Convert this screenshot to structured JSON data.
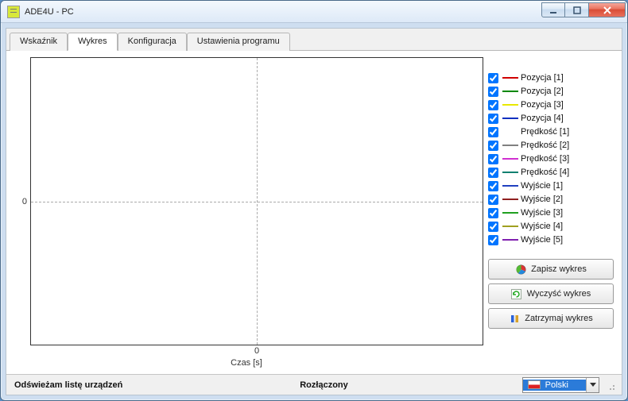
{
  "window": {
    "title": "ADE4U - PC"
  },
  "tabs": [
    {
      "label": "Wskaźnik"
    },
    {
      "label": "Wykres"
    },
    {
      "label": "Konfiguracja"
    },
    {
      "label": "Ustawienia programu"
    }
  ],
  "active_tab": 1,
  "chart_data": {
    "type": "line",
    "title": "",
    "xlabel": "Czas [s]",
    "ylabel": "",
    "x_ticks": [
      0
    ],
    "y_ticks": [
      0
    ],
    "xlim": [
      -1,
      1
    ],
    "ylim": [
      -1,
      1
    ],
    "series": [
      {
        "name": "Pozycja [1]",
        "color": "#d00000",
        "x": [],
        "y": []
      },
      {
        "name": "Pozycja [2]",
        "color": "#008800",
        "x": [],
        "y": []
      },
      {
        "name": "Pozycja [3]",
        "color": "#e8e800",
        "x": [],
        "y": []
      },
      {
        "name": "Pozycja [4]",
        "color": "#1030c0",
        "x": [],
        "y": []
      },
      {
        "name": "Prędkość [1]",
        "color": "#ffffff",
        "x": [],
        "y": []
      },
      {
        "name": "Prędkość [2]",
        "color": "#808080",
        "x": [],
        "y": []
      },
      {
        "name": "Prędkość [3]",
        "color": "#d030d0",
        "x": [],
        "y": []
      },
      {
        "name": "Prędkość [4]",
        "color": "#108070",
        "x": [],
        "y": []
      },
      {
        "name": "Wyjście [1]",
        "color": "#2040c0",
        "x": [],
        "y": []
      },
      {
        "name": "Wyjście [2]",
        "color": "#902020",
        "x": [],
        "y": []
      },
      {
        "name": "Wyjście [3]",
        "color": "#20a020",
        "x": [],
        "y": []
      },
      {
        "name": "Wyjście [4]",
        "color": "#a0a020",
        "x": [],
        "y": []
      },
      {
        "name": "Wyjście [5]",
        "color": "#8020b0",
        "x": [],
        "y": []
      }
    ]
  },
  "legend_checked": [
    true,
    true,
    true,
    true,
    true,
    true,
    true,
    true,
    true,
    true,
    true,
    true,
    true
  ],
  "buttons": {
    "save": "Zapisz wykres",
    "clear": "Wyczyść wykres",
    "stop": "Zatrzymaj wykres"
  },
  "status": {
    "left": "Odświeżam listę urządzeń",
    "center": "Rozłączony"
  },
  "language": {
    "selected": "Polski"
  }
}
